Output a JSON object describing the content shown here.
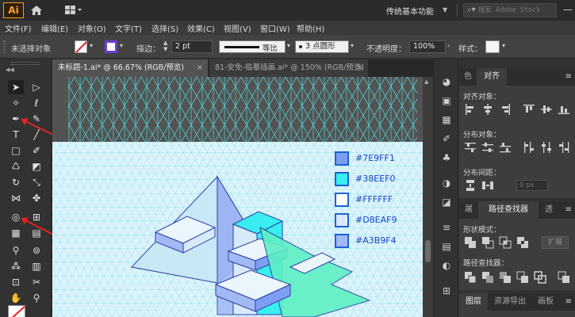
{
  "app": {
    "logo": "Ai",
    "workspace": "传统基本功能",
    "stock_search_placeholder": "搜索 Adobe Stock"
  },
  "menu": [
    "文件(F)",
    "编辑(E)",
    "对象(O)",
    "文字(T)",
    "选择(S)",
    "效果(C)",
    "视图(V)",
    "窗口(W)",
    "帮助(H)"
  ],
  "control_bar": {
    "selection_status": "未选择对象",
    "stroke_label": "描边：",
    "stroke_weight": "2 pt",
    "stroke_profile": "等比",
    "brush_size": "3",
    "brush_name": "点圆形",
    "opacity_label": "不透明度：",
    "opacity_value": "100%",
    "style_label": "样式："
  },
  "tabs": [
    {
      "label": "未标题-1.ai* @ 66.67% (RGB/预览)",
      "close": "×"
    },
    {
      "label": "81-安免-临摹插画.ai* @ 150% (RGB/预览)",
      "close": "×"
    }
  ],
  "swatches": [
    {
      "hex": "#7E9FF1",
      "label": "#7E9FF1"
    },
    {
      "hex": "#38EEF0",
      "label": "#38EEF0"
    },
    {
      "hex": "#FFFFFF",
      "label": "#FFFFFF"
    },
    {
      "hex": "#D8EAF9",
      "label": "#D8EAF9"
    },
    {
      "hex": "#A3B9F4",
      "label": "#A3B9F4"
    }
  ],
  "align_panel": {
    "tabs": [
      "色",
      "对齐"
    ],
    "align_objects": "对齐对象：",
    "distribute_objects": "分布对象：",
    "distribute_spacing": "分布间距：",
    "spacing_value": "0 px"
  },
  "pathfinder_panel": {
    "tabs": [
      "屠",
      "路径查找器",
      "透"
    ],
    "shape_modes": "形状模式：",
    "pathfinders": "路径查找器：",
    "expand": "扩展"
  },
  "layers_panel": {
    "tabs": [
      "图层",
      "资源导出",
      "画板"
    ]
  },
  "colors": {
    "accent": "#1744C7",
    "grid": "#4FD9E0",
    "arrow": "#E32424"
  }
}
